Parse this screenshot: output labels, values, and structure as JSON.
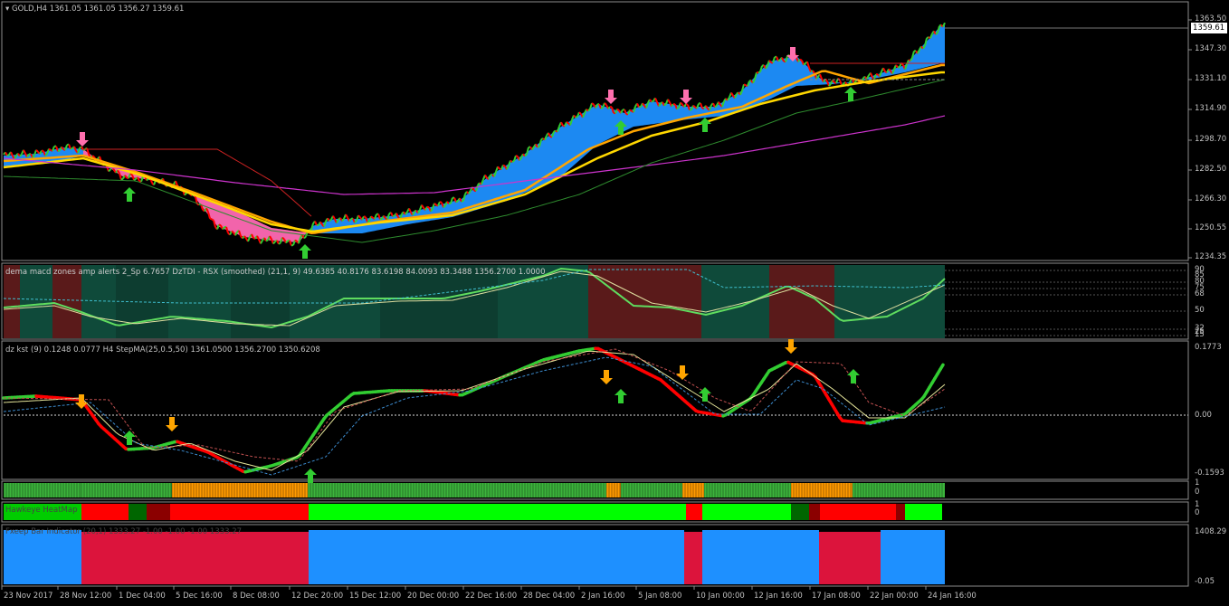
{
  "colors": {
    "background": "#000000",
    "grid": "#2a2a2a",
    "axis": "#8c8c8c",
    "bull": "#32cd32",
    "bear": "#ff0000",
    "ribbon_up": "#1e90ff",
    "ribbon_down": "#ff69b4",
    "ma_orange": "#ffa500",
    "ma_yellow": "#ffd700",
    "ma_magenta": "#cc33cc",
    "arrow_up": "#32cd32",
    "arrow_down_pink": "#ff6fae",
    "arrow_down_orange": "#ffa500",
    "zone_green": "#0f4a3a",
    "zone_red": "#5a1a1a",
    "bar_blue": "#1e90ff",
    "bar_crimson": "#dc143c"
  },
  "main_pane": {
    "title": "GOLD,H4  1361.05 1361.05 1356.27 1359.61",
    "current_price": "1359.61",
    "price_ticks": [
      "1363.50",
      "1347.30",
      "1331.10",
      "1314.90",
      "1298.70",
      "1282.50",
      "1266.30",
      "1250.55",
      "1234.35"
    ]
  },
  "rsx_pane": {
    "title": "dema macd zones amp alerts 2_Sp 6.7657  DzTDI - RSX (smoothed) (21,1, 9) 49.6385 40.8176 83.6198 84.0093 83.3488 1356.2700 1.0000",
    "ticks": [
      "90",
      "85",
      "80",
      "75",
      "68",
      "50",
      "32",
      "25",
      "15"
    ]
  },
  "kst_pane": {
    "title": "dz kst (9) 0.1248 0.0777  H4 StepMA(25,0.5,50) 1361.0500 1356.2700 1350.6208",
    "ticks": [
      "0.1773",
      "0.00",
      "-0.1593"
    ]
  },
  "strip1": {
    "label": "",
    "ticks": [
      "1",
      "0"
    ]
  },
  "heatmap": {
    "label": "Hawkeye HeatMap",
    "ticks": [
      "1",
      "0"
    ]
  },
  "fbar": {
    "label": "Fxeep Bar Indicator (20,1) 1333.27 -1.00 -1.00 -1.00 1333.27",
    "ticks": [
      "1408.29",
      "-0.05"
    ]
  },
  "dates": [
    "23 Nov 2017",
    "28 Nov 12:00",
    "1 Dec 04:00",
    "5 Dec 16:00",
    "8 Dec 08:00",
    "12 Dec 20:00",
    "15 Dec 12:00",
    "20 Dec 00:00",
    "22 Dec 16:00",
    "28 Dec 04:00",
    "2 Jan 16:00",
    "5 Jan 08:00",
    "10 Jan 00:00",
    "12 Jan 16:00",
    "17 Jan 08:00",
    "22 Jan 00:00",
    "24 Jan 16:00"
  ]
}
